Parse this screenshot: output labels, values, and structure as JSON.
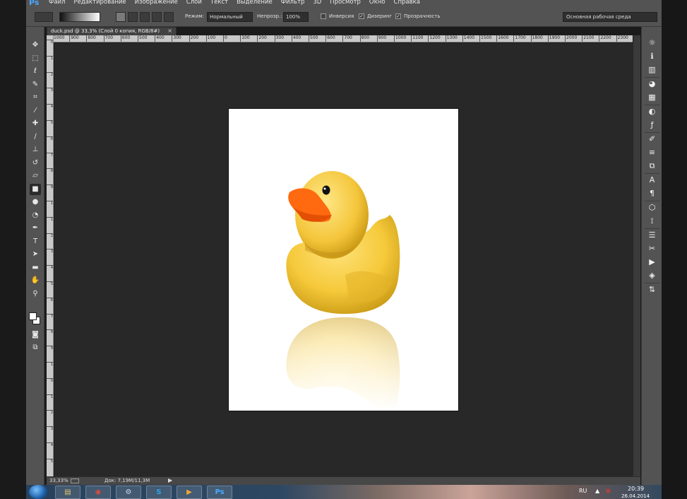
{
  "app": {
    "logo": "Ps",
    "menu": [
      "Файл",
      "Редактирование",
      "Изображение",
      "Слои",
      "Текст",
      "Выделение",
      "Фильтр",
      "3D",
      "Просмотр",
      "Окно",
      "Справка"
    ]
  },
  "options": {
    "mode_label": "Режим:",
    "mode_value": "Нормальный",
    "opacity_label": "Непрозр.:",
    "opacity_value": "100%",
    "invert_label": "Инверсия",
    "dither_label": "Дизеринг",
    "transparency_label": "Прозрачность",
    "invert_checked": false,
    "dither_checked": true,
    "transparency_checked": true,
    "workspace": "Основная рабочая среда"
  },
  "document": {
    "tab_title": "duck.psd @ 33,3% (Слой 0 копия, RGB/8#)",
    "close": "×"
  },
  "ruler": {
    "h_ticks": [
      "1000",
      "900",
      "800",
      "700",
      "600",
      "500",
      "400",
      "300",
      "200",
      "100",
      "0",
      "100",
      "200",
      "300",
      "400",
      "500",
      "600",
      "700",
      "800",
      "900",
      "1000",
      "1100",
      "1200",
      "1300",
      "1400",
      "1500",
      "1600",
      "1700",
      "1800",
      "1900",
      "2000",
      "2100",
      "2200",
      "2300"
    ],
    "v_ticks": [
      "0",
      "1",
      "2",
      "3",
      "4",
      "5",
      "6",
      "7",
      "8",
      "9",
      "1",
      "1",
      "2",
      "3",
      "4",
      "5",
      "6",
      "7",
      "8",
      "9",
      "1",
      "0",
      "1",
      "2",
      "3",
      "4",
      "5"
    ]
  },
  "status": {
    "zoom": "33,33%",
    "doc_info": "Док: 7,19M/11,3M",
    "arrow": "▶"
  },
  "tools": [
    {
      "name": "move-tool",
      "glyph": "✥"
    },
    {
      "name": "marquee-tool",
      "glyph": "⬚"
    },
    {
      "name": "lasso-tool",
      "glyph": "ℓ"
    },
    {
      "name": "quick-select-tool",
      "glyph": "✎"
    },
    {
      "name": "crop-tool",
      "glyph": "⌗"
    },
    {
      "name": "eyedropper-tool",
      "glyph": "⁄"
    },
    {
      "name": "healing-tool",
      "glyph": "✚"
    },
    {
      "name": "brush-tool",
      "glyph": "∕"
    },
    {
      "name": "stamp-tool",
      "glyph": "⊥"
    },
    {
      "name": "history-brush-tool",
      "glyph": "↺"
    },
    {
      "name": "eraser-tool",
      "glyph": "▱"
    },
    {
      "name": "gradient-tool",
      "glyph": "■"
    },
    {
      "name": "blur-tool",
      "glyph": "●"
    },
    {
      "name": "dodge-tool",
      "glyph": "◔"
    },
    {
      "name": "pen-tool",
      "glyph": "✒"
    },
    {
      "name": "type-tool",
      "glyph": "T"
    },
    {
      "name": "path-select-tool",
      "glyph": "➤"
    },
    {
      "name": "shape-tool",
      "glyph": "▬"
    },
    {
      "name": "hand-tool",
      "glyph": "✋"
    },
    {
      "name": "zoom-tool",
      "glyph": "⚲"
    }
  ],
  "panels": [
    {
      "name": "settings-panel-icon",
      "glyph": "☼"
    },
    {
      "name": "info-panel-icon",
      "glyph": "ℹ"
    },
    {
      "name": "histogram-panel-icon",
      "glyph": "▥"
    },
    {
      "name": "color-panel-icon",
      "glyph": "◕"
    },
    {
      "name": "swatches-panel-icon",
      "glyph": "▦"
    },
    {
      "name": "adjustments-panel-icon",
      "glyph": "◐"
    },
    {
      "name": "styles-panel-icon",
      "glyph": "ƒ"
    },
    {
      "name": "brush-panel-icon",
      "glyph": "✐"
    },
    {
      "name": "brush-presets-panel-icon",
      "glyph": "≡"
    },
    {
      "name": "clone-source-panel-icon",
      "glyph": "⧉"
    },
    {
      "name": "character-panel-icon",
      "glyph": "A"
    },
    {
      "name": "paragraph-panel-icon",
      "glyph": "¶"
    },
    {
      "name": "3d-panel-icon",
      "glyph": "⬡"
    },
    {
      "name": "paths-panel-icon",
      "glyph": "⟟"
    },
    {
      "name": "layer-comps-panel-icon",
      "glyph": "☰"
    },
    {
      "name": "tool-presets-panel-icon",
      "glyph": "✂"
    },
    {
      "name": "actions-panel-icon",
      "glyph": "▶"
    },
    {
      "name": "layers-panel-icon",
      "glyph": "◈"
    },
    {
      "name": "channels-panel-icon",
      "glyph": "⇅"
    }
  ],
  "taskbar": {
    "tasks": [
      {
        "name": "explorer-task",
        "glyph": "▤",
        "color": "#e3c36a"
      },
      {
        "name": "chrome-task",
        "glyph": "◉",
        "color": "#e04b3a"
      },
      {
        "name": "steam-task",
        "glyph": "⚙",
        "color": "#cfd8e3"
      },
      {
        "name": "skype-task",
        "glyph": "S",
        "color": "#2aa7e8"
      },
      {
        "name": "media-player-task",
        "glyph": "▶",
        "color": "#f0a534"
      },
      {
        "name": "photoshop-task",
        "glyph": "Ps",
        "color": "#4aa8ff"
      }
    ],
    "lang": "RU",
    "time": "20:39",
    "date": "26.04.2014"
  }
}
